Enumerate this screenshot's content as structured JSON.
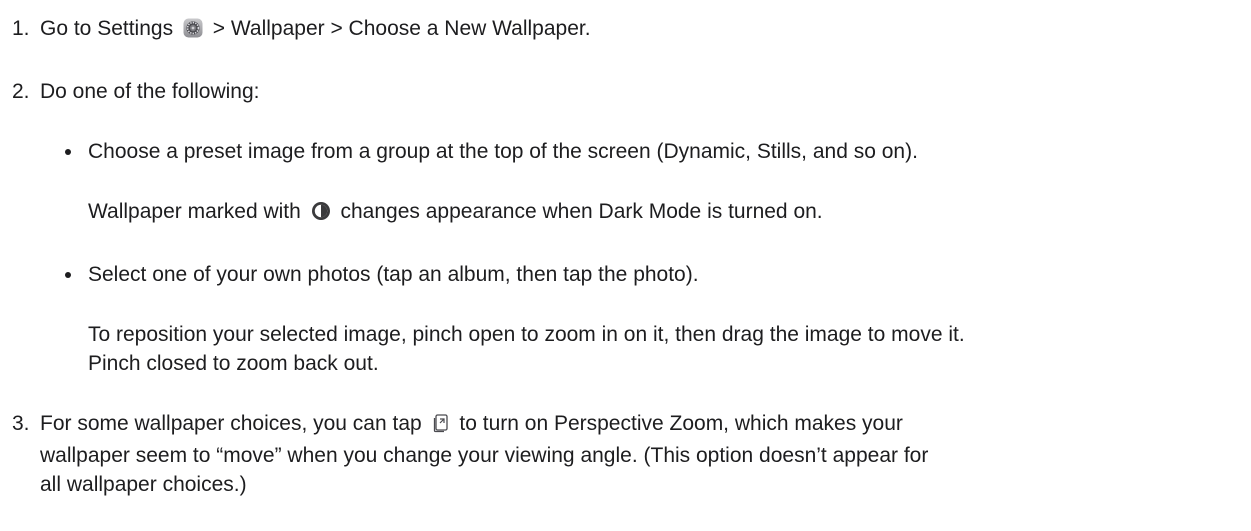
{
  "steps": [
    {
      "number": "1.",
      "text_before_icon": "Go to Settings",
      "icon": "settings-gear-icon",
      "text_after_icon": "> Wallpaper > Choose a New Wallpaper."
    },
    {
      "number": "2.",
      "text": "Do one of the following:",
      "bullets": [
        {
          "text": "Choose a preset image from a group at the top of the screen (Dynamic, Stills, and so on).",
          "note_before_icon": "Wallpaper marked with",
          "note_icon": "dark-mode-appearance-icon",
          "note_after_icon": "changes appearance when Dark Mode is turned on."
        },
        {
          "text": "Select one of your own photos (tap an album, then tap the photo).",
          "note_line1": "To reposition your selected image, pinch open to zoom in on it, then drag the image to move it.",
          "note_line2": "Pinch closed to zoom back out."
        }
      ]
    },
    {
      "number": "3.",
      "text_before_icon": "For some wallpaper choices, you can tap",
      "icon": "perspective-zoom-icon",
      "text_line1_after_icon": "to turn on Perspective Zoom, which makes your",
      "text_line2": "wallpaper seem to “move” when you change your viewing angle. (This option doesn’t appear for",
      "text_line3": "all wallpaper choices.)"
    }
  ]
}
